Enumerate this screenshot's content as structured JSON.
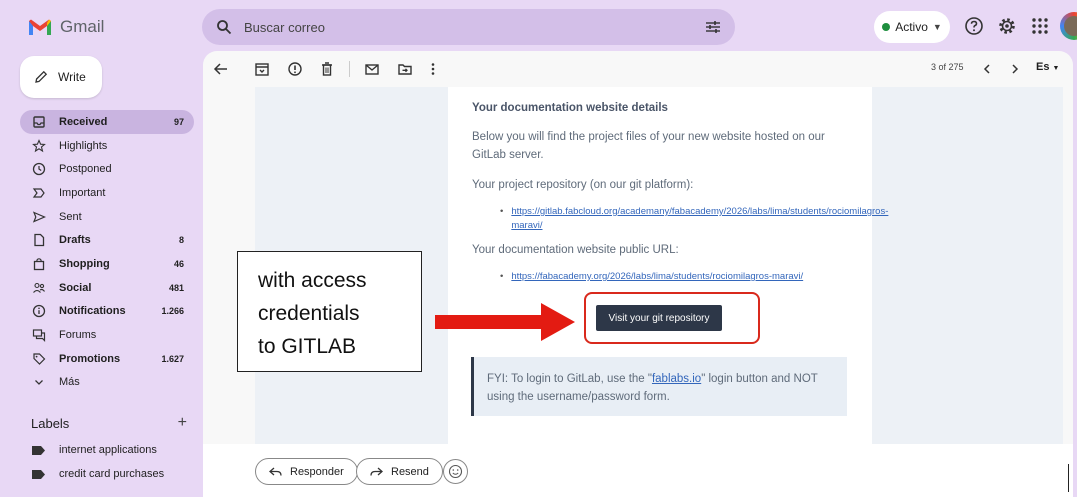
{
  "app": {
    "name": "Gmail"
  },
  "search": {
    "placeholder": "Buscar correo"
  },
  "status": {
    "label": "Activo",
    "color": "#1e8e3e"
  },
  "compose": {
    "label": "Write"
  },
  "sidebar": {
    "items": [
      {
        "label": "Received",
        "count": "97",
        "icon": "inbox-icon",
        "bold": true,
        "active": true
      },
      {
        "label": "Highlights",
        "count": "",
        "icon": "star-icon",
        "bold": false
      },
      {
        "label": "Postponed",
        "count": "",
        "icon": "clock-icon",
        "bold": false
      },
      {
        "label": "Important",
        "count": "",
        "icon": "important-icon",
        "bold": false
      },
      {
        "label": "Sent",
        "count": "",
        "icon": "send-icon",
        "bold": false
      },
      {
        "label": "Drafts",
        "count": "8",
        "icon": "draft-icon",
        "bold": true
      },
      {
        "label": "Shopping",
        "count": "46",
        "icon": "shopping-icon",
        "bold": true
      },
      {
        "label": "Social",
        "count": "481",
        "icon": "people-icon",
        "bold": true
      },
      {
        "label": "Notifications",
        "count": "1.266",
        "icon": "info-icon",
        "bold": true
      },
      {
        "label": "Forums",
        "count": "",
        "icon": "forum-icon",
        "bold": false
      },
      {
        "label": "Promotions",
        "count": "1.627",
        "icon": "tag-icon",
        "bold": true
      },
      {
        "label": "Más",
        "count": "",
        "icon": "chevron-down-icon",
        "bold": false
      }
    ],
    "labels_title": "Labels",
    "labels": [
      "internet applications",
      "credit card purchases"
    ]
  },
  "toolbar": {
    "pager": "3 of 275",
    "language": "Es"
  },
  "email": {
    "title": "Your documentation website details",
    "intro": "Below you will find the project files of your new website hosted on our GitLab server.",
    "repo_label": "Your project repository (on our git platform):",
    "repo_url": "https://gitlab.fabcloud.org/academany/fabacademy/2026/labs/lima/students/rociomilagros-maravi/",
    "site_label": "Your documentation website public URL:",
    "site_url": "https://fabacademy.org/2026/labs/lima/students/rociomilagros-maravi/",
    "button_label": "Visit your git repository",
    "fyi_before": "FYI: To login to GitLab, use the \"",
    "fyi_link": "fablabs.io",
    "fyi_after": "\" login button and NOT using the username/password form."
  },
  "reply": {
    "reply_label": "Responder",
    "forward_label": "Resend"
  },
  "annotation": {
    "text": "with access\ncredentials\nto GITLAB",
    "arrow_color": "#e31b12",
    "box_color": "#d9291c"
  }
}
